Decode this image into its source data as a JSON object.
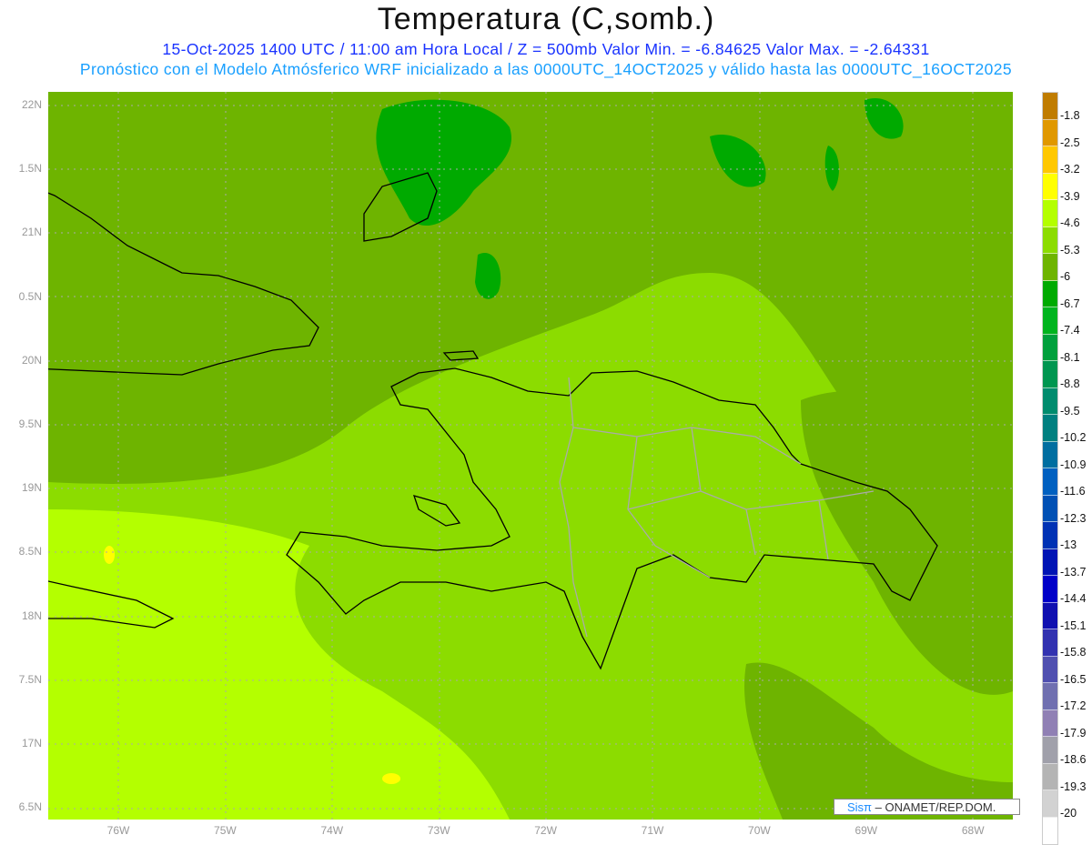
{
  "title": "Temperatura (C,somb.)",
  "subtitle1": "15-Oct-2025  1400 UTC / 11:00 am Hora Local / Z = 500mb  Valor Min. = -6.84625  Valor Max. = -2.64331",
  "subtitle2": "Pronóstico con el Modelo Atmósferico WRF inicializado a las 0000UTC_14OCT2025 y válido hasta las  0000UTC_16OCT2025",
  "lat_labels": [
    "22N",
    "1.5N",
    "21N",
    "0.5N",
    "20N",
    "9.5N",
    "19N",
    "8.5N",
    "18N",
    "7.5N",
    "17N",
    "6.5N"
  ],
  "lon_labels": [
    "76W",
    "75W",
    "74W",
    "73W",
    "72W",
    "71W",
    "70W",
    "69W",
    "68W"
  ],
  "colorbar": {
    "labels": [
      "-1.8",
      "-2.5",
      "-3.2",
      "-3.9",
      "-4.6",
      "-5.3",
      "-6",
      "-6.7",
      "-7.4",
      "-8.1",
      "-8.8",
      "-9.5",
      "-10.2",
      "-10.9",
      "-11.6",
      "-12.3",
      "-13",
      "-13.7",
      "-14.4",
      "-15.1",
      "-15.8",
      "-16.5",
      "-17.2",
      "-17.9",
      "-18.6",
      "-19.3",
      "-20"
    ],
    "colors": [
      "#c07c00",
      "#e09800",
      "#ffc800",
      "#ffff00",
      "#b4ff00",
      "#8cdc00",
      "#6eb400",
      "#00aa00",
      "#00b41e",
      "#00a03c",
      "#009650",
      "#008c6e",
      "#008080",
      "#006ea0",
      "#0060c0",
      "#0050b4",
      "#0032b4",
      "#0014b4",
      "#0000c8",
      "#1010b0",
      "#3232b0",
      "#5050b0",
      "#7070b0",
      "#9080b4",
      "#a0a0aa",
      "#b4b4b4",
      "#d2d2d2",
      "#ffffff"
    ]
  },
  "credit": {
    "logo": "Sisπ",
    "text": " – ONAMET/REP.DOM."
  }
}
